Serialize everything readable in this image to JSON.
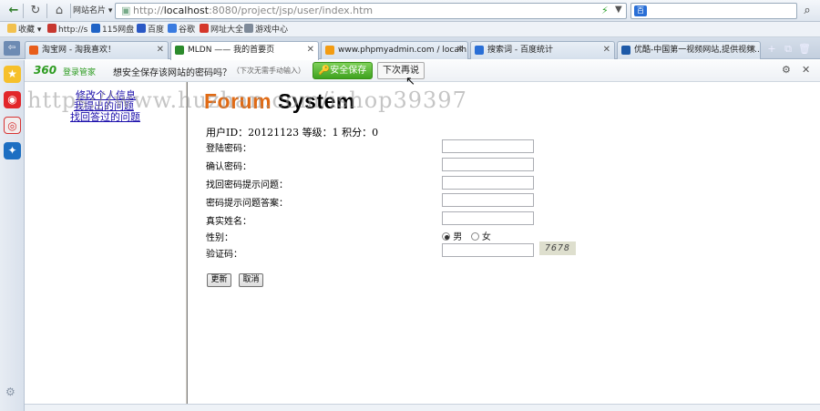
{
  "browser": {
    "site_cards": "网站名片",
    "url_prefix": "http://",
    "url_host": "localhost",
    "url_rest": ":8080/project/jsp/user/index.htm",
    "search_engine": "百",
    "favorites": [
      "收藏",
      "http://s",
      "115网盘",
      "百度",
      "谷歌",
      "网址大全",
      "游戏中心"
    ],
    "tabs": [
      {
        "title": "淘宝网 - 淘我喜欢！",
        "color": "#e85d1a"
      },
      {
        "title": "MLDN —— 我的首要页",
        "color": "#2c8b2c"
      },
      {
        "title": "www.phpmyadmin.com / localh...",
        "color": "#f39c12"
      },
      {
        "title": "搜索词 - 百度统计",
        "color": "#2a6fd6"
      },
      {
        "title": "优酷-中国第一视频网站,提供视频...",
        "color": "#1e5aa8"
      }
    ]
  },
  "password_bar": {
    "logo": "360",
    "logo_sub": "登录管家",
    "question": "想安全保存该网站的密码吗？",
    "hint": "（下次无需手动输入）",
    "save_label": "安全保存",
    "later_label": "下次再说"
  },
  "left_menu": [
    "修改个人信息",
    "我提出的问题",
    "找回答过的问题"
  ],
  "main": {
    "title_a": "Forum",
    "title_b": " System",
    "info": "用户ID：20121123  等级：1  积分：0",
    "fields": [
      "登陆密码：",
      "确认密码：",
      "找回密码提示问题：",
      "密码提示问题答案：",
      "真实姓名："
    ],
    "gender_label": "性别：",
    "gender_male": "男",
    "gender_female": "女",
    "captcha_label": "验证码：",
    "captcha_value": "7678",
    "update_label": "更新",
    "cancel_label": "取消"
  },
  "watermark": "https://www.huzhan.com/ishop39397"
}
